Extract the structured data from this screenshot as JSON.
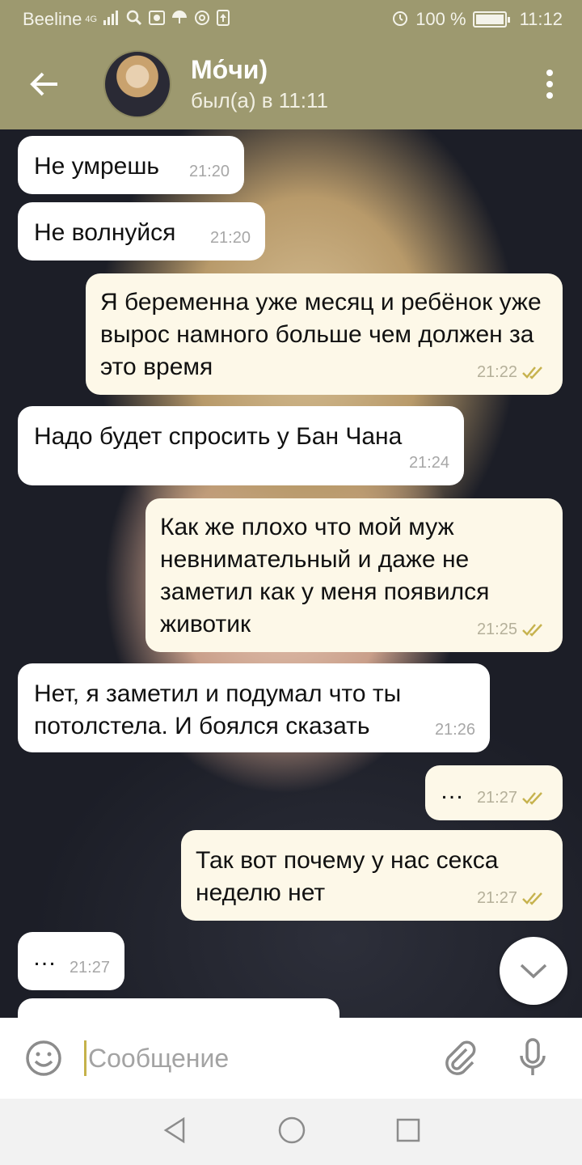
{
  "status_bar": {
    "carrier": "Beeline",
    "network": "4G",
    "battery": "100 %",
    "battery_level": 1.0,
    "time": "11:12"
  },
  "header": {
    "chat_name": "Мо́чи)",
    "last_seen": "был(а) в 11:11"
  },
  "messages": [
    {
      "direction": "in",
      "text": "Не умрешь",
      "time": "21:20"
    },
    {
      "direction": "in",
      "text": "Не волнуйся",
      "time": "21:20"
    },
    {
      "direction": "out",
      "text": "Я беременна уже месяц и ребёнок уже вырос намного больше чем должен за это время",
      "time": "21:22",
      "read": true
    },
    {
      "direction": "in",
      "text": "Надо будет спросить у Бан Чана",
      "time": "21:24"
    },
    {
      "direction": "out",
      "text": "Как же плохо что мой муж невнимательный и даже не заметил как у меня появился животик",
      "time": "21:25",
      "read": true
    },
    {
      "direction": "in",
      "text": "Нет, я заметил и подумал что ты потолстела. И боялся сказать",
      "time": "21:26"
    },
    {
      "direction": "out",
      "text": "…",
      "time": "21:27",
      "read": true
    },
    {
      "direction": "out",
      "text": "Так вот почему у нас секса неделю нет",
      "time": "21:27",
      "read": true
    },
    {
      "direction": "in",
      "text": "…",
      "time": "21:27"
    }
  ],
  "input": {
    "placeholder": "Сообщение"
  },
  "colors": {
    "header": "#9d996f",
    "incoming_bubble": "#ffffff",
    "outgoing_bubble": "#fdf8e8",
    "read_checks": "#c7b34f"
  },
  "icons": {
    "back": "arrow-left-icon",
    "menu": "more-vertical-icon",
    "scroll_down": "chevron-down-icon",
    "emoji": "smile-icon",
    "attach": "paperclip-icon",
    "mic": "microphone-icon",
    "nav_back": "triangle-back-icon",
    "nav_home": "circle-home-icon",
    "nav_recents": "square-recents-icon"
  }
}
